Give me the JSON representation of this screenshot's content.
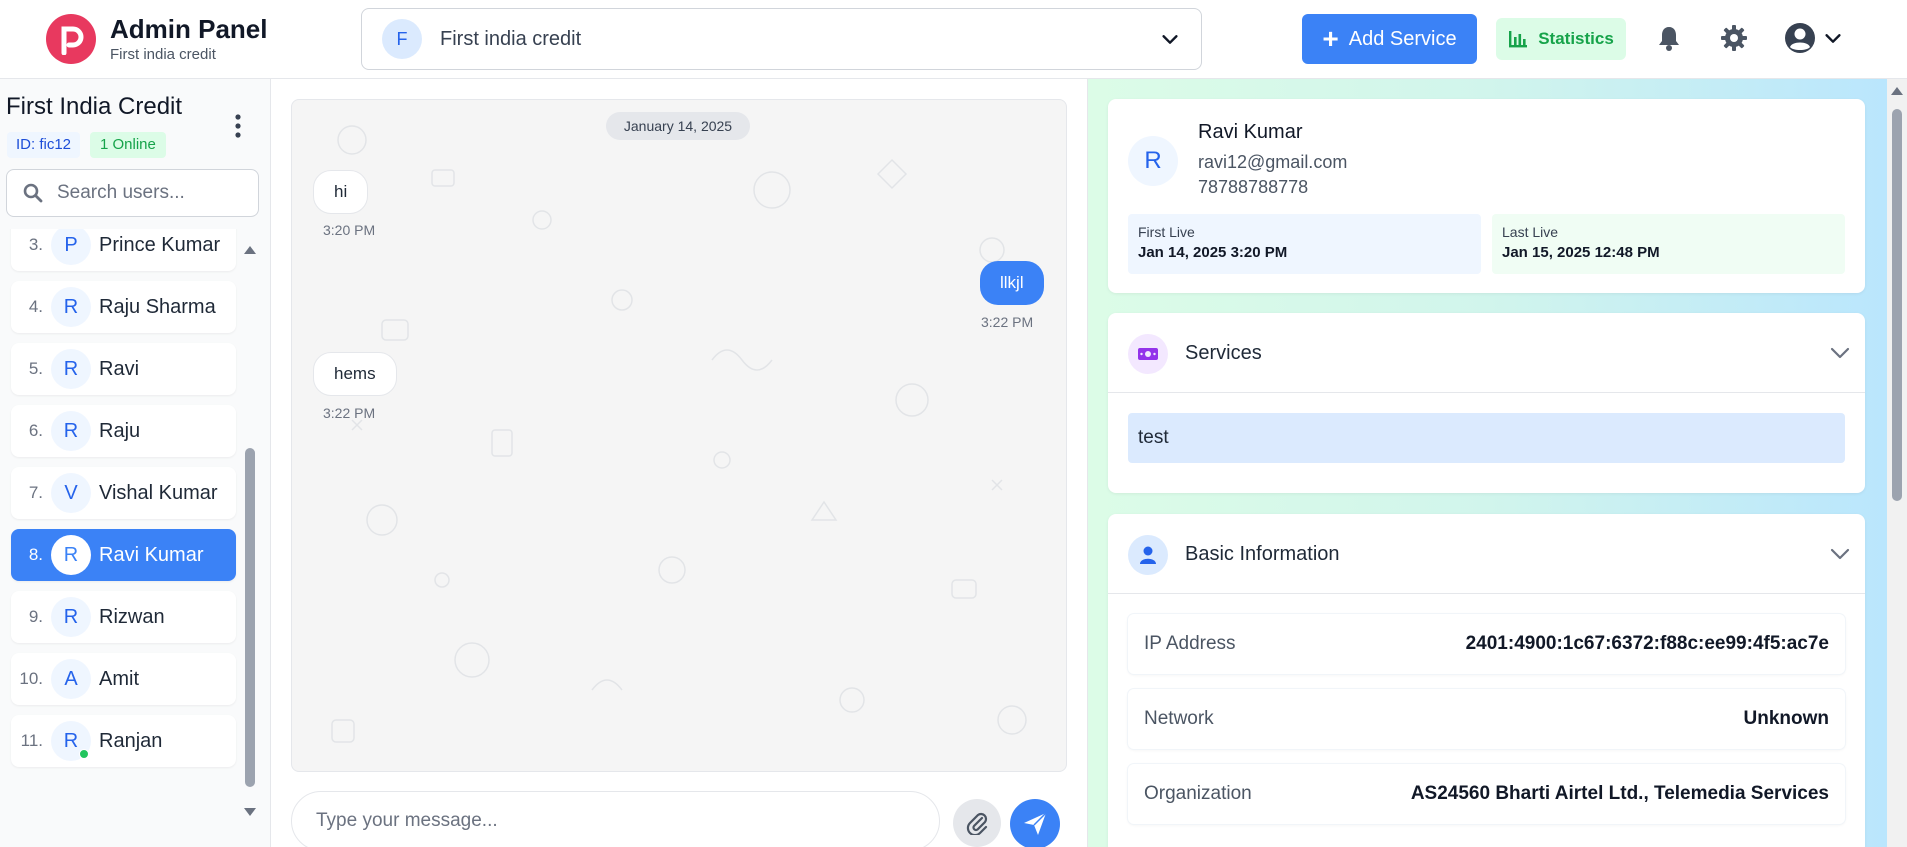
{
  "header": {
    "app_title": "Admin Panel",
    "app_subtitle": "First india credit",
    "company_select": {
      "avatar_letter": "F",
      "value": "First india credit"
    },
    "add_service_label": "Add Service",
    "statistics_label": "Statistics"
  },
  "sidebar": {
    "title": "First India Credit",
    "id_badge": "ID: fic12",
    "online_badge": "1 Online",
    "search_placeholder": "Search users...",
    "users": [
      {
        "num": "3.",
        "letter": "P",
        "name": "Prince Kumar"
      },
      {
        "num": "4.",
        "letter": "R",
        "name": "Raju Sharma"
      },
      {
        "num": "5.",
        "letter": "R",
        "name": "Ravi"
      },
      {
        "num": "6.",
        "letter": "R",
        "name": "Raju"
      },
      {
        "num": "7.",
        "letter": "V",
        "name": "Vishal Kumar"
      },
      {
        "num": "8.",
        "letter": "R",
        "name": "Ravi Kumar"
      },
      {
        "num": "9.",
        "letter": "R",
        "name": "Rizwan"
      },
      {
        "num": "10.",
        "letter": "A",
        "name": "Amit"
      },
      {
        "num": "11.",
        "letter": "R",
        "name": "Ranjan"
      }
    ]
  },
  "chat": {
    "date_label": "January 14, 2025",
    "messages": [
      {
        "text": "hi",
        "time": "3:20 PM",
        "direction": "in"
      },
      {
        "text": "llkjl",
        "time": "3:22 PM",
        "direction": "out"
      },
      {
        "text": "hems",
        "time": "3:22 PM",
        "direction": "in"
      }
    ],
    "input_placeholder": "Type your message..."
  },
  "user_detail": {
    "avatar_letter": "R",
    "name": "Ravi Kumar",
    "email": "ravi12@gmail.com",
    "phone": "78788788778",
    "first_live_label": "First Live",
    "first_live_value": "Jan 14, 2025 3:20 PM",
    "last_live_label": "Last Live",
    "last_live_value": "Jan 15, 2025 12:48 PM"
  },
  "services": {
    "title": "Services",
    "items": [
      "test"
    ]
  },
  "basic_info": {
    "title": "Basic Information",
    "rows": [
      {
        "label": "IP Address",
        "value": "2401:4900:1c67:6372:f88c:ee99:4f5:ac7e"
      },
      {
        "label": "Network",
        "value": "Unknown"
      },
      {
        "label": "Organization",
        "value": "AS24560 Bharti Airtel Ltd., Telemedia Services"
      }
    ]
  },
  "colors": {
    "primary": "#3b82f6",
    "brand": "#e8395f",
    "success": "#16a34a"
  }
}
